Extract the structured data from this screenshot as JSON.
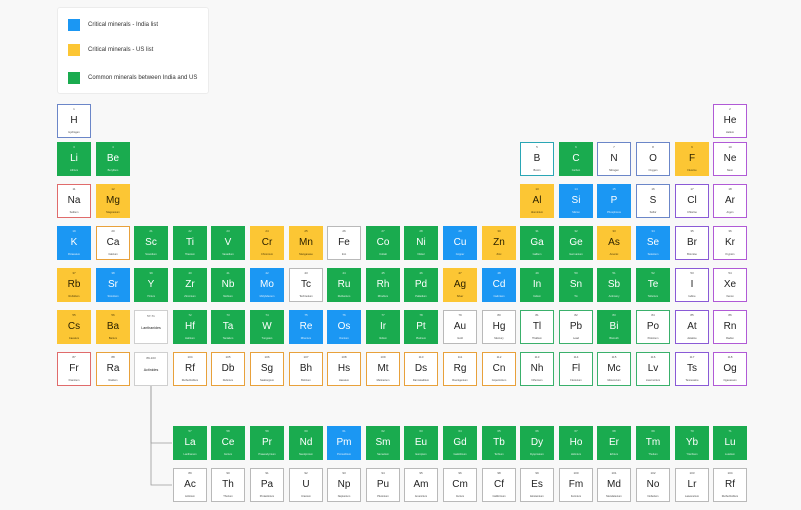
{
  "legend": {
    "items": [
      {
        "label": "Critical minerals - India list",
        "color": "#1b97f3"
      },
      {
        "label": "Critical minerals - US list",
        "color": "#fcc634"
      },
      {
        "label": "Common minerals between India and US",
        "color": "#1aab4f"
      }
    ]
  },
  "colors": {
    "india": "#1b97f3",
    "us": "#fcc634",
    "both": "#1aab4f",
    "group_borders": {
      "nonmetal": "#6b86c8",
      "alkali": "#e06b6b",
      "alkaline": "#e8a13b",
      "transition": "#b9b9b9",
      "post": "#3ab06b",
      "metalloid": "#2aa6b5",
      "halogen": "#8a5ad6",
      "noble": "#b05ad6"
    }
  },
  "placeholders": {
    "lanthanides": {
      "number": "57-71",
      "label": "Lanthanides"
    },
    "actinides": {
      "number": "89-103",
      "label": "Actinides"
    }
  },
  "elements": [
    {
      "sym": "H",
      "num": "1",
      "name": "Hydrogen",
      "row": 1,
      "col": 1,
      "cat": "none",
      "group": "nonmetal"
    },
    {
      "sym": "He",
      "num": "2",
      "name": "Helium",
      "row": 1,
      "col": 18,
      "cat": "none",
      "group": "noble"
    },
    {
      "sym": "Li",
      "num": "3",
      "name": "Lithium",
      "row": 2,
      "col": 1,
      "cat": "both",
      "group": "alkali"
    },
    {
      "sym": "Be",
      "num": "4",
      "name": "Beryllium",
      "row": 2,
      "col": 2,
      "cat": "both",
      "group": "alkaline"
    },
    {
      "sym": "B",
      "num": "5",
      "name": "Boron",
      "row": 2,
      "col": 13,
      "cat": "none",
      "group": "metalloid"
    },
    {
      "sym": "C",
      "num": "6",
      "name": "Carbon",
      "row": 2,
      "col": 14,
      "cat": "both",
      "group": "nonmetal"
    },
    {
      "sym": "N",
      "num": "7",
      "name": "Nitrogen",
      "row": 2,
      "col": 15,
      "cat": "none",
      "group": "nonmetal"
    },
    {
      "sym": "O",
      "num": "8",
      "name": "Oxygen",
      "row": 2,
      "col": 16,
      "cat": "none",
      "group": "nonmetal"
    },
    {
      "sym": "F",
      "num": "9",
      "name": "Fluorine",
      "row": 2,
      "col": 17,
      "cat": "us",
      "group": "halogen"
    },
    {
      "sym": "Ne",
      "num": "10",
      "name": "Neon",
      "row": 2,
      "col": 18,
      "cat": "none",
      "group": "noble"
    },
    {
      "sym": "Na",
      "num": "11",
      "name": "Sodium",
      "row": 3,
      "col": 1,
      "cat": "none",
      "group": "alkali"
    },
    {
      "sym": "Mg",
      "num": "12",
      "name": "Magnesium",
      "row": 3,
      "col": 2,
      "cat": "us",
      "group": "alkaline"
    },
    {
      "sym": "Al",
      "num": "13",
      "name": "Aluminium",
      "row": 3,
      "col": 13,
      "cat": "us",
      "group": "post"
    },
    {
      "sym": "Si",
      "num": "14",
      "name": "Silicon",
      "row": 3,
      "col": 14,
      "cat": "india",
      "group": "metalloid"
    },
    {
      "sym": "P",
      "num": "15",
      "name": "Phosphorus",
      "row": 3,
      "col": 15,
      "cat": "india",
      "group": "nonmetal"
    },
    {
      "sym": "S",
      "num": "16",
      "name": "Sulfur",
      "row": 3,
      "col": 16,
      "cat": "none",
      "group": "nonmetal"
    },
    {
      "sym": "Cl",
      "num": "17",
      "name": "Chlorine",
      "row": 3,
      "col": 17,
      "cat": "none",
      "group": "halogen"
    },
    {
      "sym": "Ar",
      "num": "18",
      "name": "Argon",
      "row": 3,
      "col": 18,
      "cat": "none",
      "group": "noble"
    },
    {
      "sym": "K",
      "num": "19",
      "name": "Potassium",
      "row": 4,
      "col": 1,
      "cat": "india",
      "group": "alkali"
    },
    {
      "sym": "Ca",
      "num": "20",
      "name": "Calcium",
      "row": 4,
      "col": 2,
      "cat": "none",
      "group": "alkaline"
    },
    {
      "sym": "Sc",
      "num": "21",
      "name": "Scandium",
      "row": 4,
      "col": 3,
      "cat": "both",
      "group": "transition"
    },
    {
      "sym": "Ti",
      "num": "22",
      "name": "Titanium",
      "row": 4,
      "col": 4,
      "cat": "both",
      "group": "transition"
    },
    {
      "sym": "V",
      "num": "23",
      "name": "Vanadium",
      "row": 4,
      "col": 5,
      "cat": "both",
      "group": "transition"
    },
    {
      "sym": "Cr",
      "num": "24",
      "name": "Chromium",
      "row": 4,
      "col": 6,
      "cat": "us",
      "group": "transition"
    },
    {
      "sym": "Mn",
      "num": "25",
      "name": "Manganese",
      "row": 4,
      "col": 7,
      "cat": "us",
      "group": "transition"
    },
    {
      "sym": "Fe",
      "num": "26",
      "name": "Iron",
      "row": 4,
      "col": 8,
      "cat": "none",
      "group": "transition"
    },
    {
      "sym": "Co",
      "num": "27",
      "name": "Cobalt",
      "row": 4,
      "col": 9,
      "cat": "both",
      "group": "transition"
    },
    {
      "sym": "Ni",
      "num": "28",
      "name": "Nickel",
      "row": 4,
      "col": 10,
      "cat": "both",
      "group": "transition"
    },
    {
      "sym": "Cu",
      "num": "29",
      "name": "Copper",
      "row": 4,
      "col": 11,
      "cat": "india",
      "group": "transition"
    },
    {
      "sym": "Zn",
      "num": "30",
      "name": "Zinc",
      "row": 4,
      "col": 12,
      "cat": "us",
      "group": "transition"
    },
    {
      "sym": "Ga",
      "num": "31",
      "name": "Gallium",
      "row": 4,
      "col": 13,
      "cat": "both",
      "group": "post"
    },
    {
      "sym": "Ge",
      "num": "32",
      "name": "Germanium",
      "row": 4,
      "col": 14,
      "cat": "both",
      "group": "metalloid"
    },
    {
      "sym": "As",
      "num": "33",
      "name": "Arsenic",
      "row": 4,
      "col": 15,
      "cat": "us",
      "group": "metalloid"
    },
    {
      "sym": "Se",
      "num": "34",
      "name": "Selenium",
      "row": 4,
      "col": 16,
      "cat": "india",
      "group": "nonmetal"
    },
    {
      "sym": "Br",
      "num": "35",
      "name": "Bromine",
      "row": 4,
      "col": 17,
      "cat": "none",
      "group": "halogen"
    },
    {
      "sym": "Kr",
      "num": "36",
      "name": "Krypton",
      "row": 4,
      "col": 18,
      "cat": "none",
      "group": "noble"
    },
    {
      "sym": "Rb",
      "num": "37",
      "name": "Rubidium",
      "row": 5,
      "col": 1,
      "cat": "us",
      "group": "alkali"
    },
    {
      "sym": "Sr",
      "num": "38",
      "name": "Strontium",
      "row": 5,
      "col": 2,
      "cat": "india",
      "group": "alkaline"
    },
    {
      "sym": "Y",
      "num": "39",
      "name": "Yttrium",
      "row": 5,
      "col": 3,
      "cat": "both",
      "group": "transition"
    },
    {
      "sym": "Zr",
      "num": "40",
      "name": "Zirconium",
      "row": 5,
      "col": 4,
      "cat": "both",
      "group": "transition"
    },
    {
      "sym": "Nb",
      "num": "41",
      "name": "Niobium",
      "row": 5,
      "col": 5,
      "cat": "both",
      "group": "transition"
    },
    {
      "sym": "Mo",
      "num": "42",
      "name": "Molybdenum",
      "row": 5,
      "col": 6,
      "cat": "india",
      "group": "transition"
    },
    {
      "sym": "Tc",
      "num": "43",
      "name": "Technetium",
      "row": 5,
      "col": 7,
      "cat": "none",
      "group": "transition"
    },
    {
      "sym": "Ru",
      "num": "44",
      "name": "Ruthenium",
      "row": 5,
      "col": 8,
      "cat": "both",
      "group": "transition"
    },
    {
      "sym": "Rh",
      "num": "45",
      "name": "Rhodium",
      "row": 5,
      "col": 9,
      "cat": "both",
      "group": "transition"
    },
    {
      "sym": "Pd",
      "num": "46",
      "name": "Palladium",
      "row": 5,
      "col": 10,
      "cat": "both",
      "group": "transition"
    },
    {
      "sym": "Ag",
      "num": "47",
      "name": "Silver",
      "row": 5,
      "col": 11,
      "cat": "us",
      "group": "transition"
    },
    {
      "sym": "Cd",
      "num": "48",
      "name": "Cadmium",
      "row": 5,
      "col": 12,
      "cat": "india",
      "group": "transition"
    },
    {
      "sym": "In",
      "num": "49",
      "name": "Indium",
      "row": 5,
      "col": 13,
      "cat": "both",
      "group": "post"
    },
    {
      "sym": "Sn",
      "num": "50",
      "name": "Tin",
      "row": 5,
      "col": 14,
      "cat": "both",
      "group": "post"
    },
    {
      "sym": "Sb",
      "num": "51",
      "name": "Antimony",
      "row": 5,
      "col": 15,
      "cat": "both",
      "group": "metalloid"
    },
    {
      "sym": "Te",
      "num": "52",
      "name": "Tellurium",
      "row": 5,
      "col": 16,
      "cat": "both",
      "group": "metalloid"
    },
    {
      "sym": "I",
      "num": "53",
      "name": "Iodine",
      "row": 5,
      "col": 17,
      "cat": "none",
      "group": "halogen"
    },
    {
      "sym": "Xe",
      "num": "54",
      "name": "Xenon",
      "row": 5,
      "col": 18,
      "cat": "none",
      "group": "noble"
    },
    {
      "sym": "Cs",
      "num": "55",
      "name": "Caesium",
      "row": 6,
      "col": 1,
      "cat": "us",
      "group": "alkali"
    },
    {
      "sym": "Ba",
      "num": "56",
      "name": "Barium",
      "row": 6,
      "col": 2,
      "cat": "us",
      "group": "alkaline"
    },
    {
      "sym": "Hf",
      "num": "72",
      "name": "Hafnium",
      "row": 6,
      "col": 4,
      "cat": "both",
      "group": "transition"
    },
    {
      "sym": "Ta",
      "num": "73",
      "name": "Tantalum",
      "row": 6,
      "col": 5,
      "cat": "both",
      "group": "transition"
    },
    {
      "sym": "W",
      "num": "74",
      "name": "Tungsten",
      "row": 6,
      "col": 6,
      "cat": "both",
      "group": "transition"
    },
    {
      "sym": "Re",
      "num": "75",
      "name": "Rhenium",
      "row": 6,
      "col": 7,
      "cat": "india",
      "group": "transition"
    },
    {
      "sym": "Os",
      "num": "76",
      "name": "Osmium",
      "row": 6,
      "col": 8,
      "cat": "india",
      "group": "transition"
    },
    {
      "sym": "Ir",
      "num": "77",
      "name": "Iridium",
      "row": 6,
      "col": 9,
      "cat": "both",
      "group": "transition"
    },
    {
      "sym": "Pt",
      "num": "78",
      "name": "Platinum",
      "row": 6,
      "col": 10,
      "cat": "both",
      "group": "transition"
    },
    {
      "sym": "Au",
      "num": "79",
      "name": "Gold",
      "row": 6,
      "col": 11,
      "cat": "none",
      "group": "transition"
    },
    {
      "sym": "Hg",
      "num": "80",
      "name": "Mercury",
      "row": 6,
      "col": 12,
      "cat": "none",
      "group": "transition"
    },
    {
      "sym": "Tl",
      "num": "81",
      "name": "Thallium",
      "row": 6,
      "col": 13,
      "cat": "none",
      "group": "post"
    },
    {
      "sym": "Pb",
      "num": "82",
      "name": "Lead",
      "row": 6,
      "col": 14,
      "cat": "none",
      "group": "post"
    },
    {
      "sym": "Bi",
      "num": "83",
      "name": "Bismuth",
      "row": 6,
      "col": 15,
      "cat": "both",
      "group": "post"
    },
    {
      "sym": "Po",
      "num": "84",
      "name": "Polonium",
      "row": 6,
      "col": 16,
      "cat": "none",
      "group": "post"
    },
    {
      "sym": "At",
      "num": "85",
      "name": "Astatine",
      "row": 6,
      "col": 17,
      "cat": "none",
      "group": "halogen"
    },
    {
      "sym": "Rn",
      "num": "86",
      "name": "Radon",
      "row": 6,
      "col": 18,
      "cat": "none",
      "group": "noble"
    },
    {
      "sym": "Fr",
      "num": "87",
      "name": "Francium",
      "row": 7,
      "col": 1,
      "cat": "none",
      "group": "alkali"
    },
    {
      "sym": "Ra",
      "num": "88",
      "name": "Radium",
      "row": 7,
      "col": 2,
      "cat": "none",
      "group": "alkaline"
    },
    {
      "sym": "Rf",
      "num": "104",
      "name": "Rutherfordium",
      "row": 7,
      "col": 4,
      "cat": "none",
      "group": "alkaline"
    },
    {
      "sym": "Db",
      "num": "105",
      "name": "Dubnium",
      "row": 7,
      "col": 5,
      "cat": "none",
      "group": "alkaline"
    },
    {
      "sym": "Sg",
      "num": "106",
      "name": "Seaborgium",
      "row": 7,
      "col": 6,
      "cat": "none",
      "group": "alkaline"
    },
    {
      "sym": "Bh",
      "num": "107",
      "name": "Bohrium",
      "row": 7,
      "col": 7,
      "cat": "none",
      "group": "alkaline"
    },
    {
      "sym": "Hs",
      "num": "108",
      "name": "Hassium",
      "row": 7,
      "col": 8,
      "cat": "none",
      "group": "alkaline"
    },
    {
      "sym": "Mt",
      "num": "109",
      "name": "Meitnerium",
      "row": 7,
      "col": 9,
      "cat": "none",
      "group": "alkaline"
    },
    {
      "sym": "Ds",
      "num": "110",
      "name": "Darmstadtium",
      "row": 7,
      "col": 10,
      "cat": "none",
      "group": "alkaline"
    },
    {
      "sym": "Rg",
      "num": "111",
      "name": "Roentgenium",
      "row": 7,
      "col": 11,
      "cat": "none",
      "group": "alkaline"
    },
    {
      "sym": "Cn",
      "num": "112",
      "name": "Copernicium",
      "row": 7,
      "col": 12,
      "cat": "none",
      "group": "alkaline"
    },
    {
      "sym": "Nh",
      "num": "113",
      "name": "Nihonium",
      "row": 7,
      "col": 13,
      "cat": "none",
      "group": "post"
    },
    {
      "sym": "Fl",
      "num": "114",
      "name": "Flerovium",
      "row": 7,
      "col": 14,
      "cat": "none",
      "group": "post"
    },
    {
      "sym": "Mc",
      "num": "115",
      "name": "Moscovium",
      "row": 7,
      "col": 15,
      "cat": "none",
      "group": "post"
    },
    {
      "sym": "Lv",
      "num": "116",
      "name": "Livermorium",
      "row": 7,
      "col": 16,
      "cat": "none",
      "group": "post"
    },
    {
      "sym": "Ts",
      "num": "117",
      "name": "Tennessine",
      "row": 7,
      "col": 17,
      "cat": "none",
      "group": "halogen"
    },
    {
      "sym": "Og",
      "num": "118",
      "name": "Oganesson",
      "row": 7,
      "col": 18,
      "cat": "none",
      "group": "noble"
    },
    {
      "sym": "La",
      "num": "57",
      "name": "Lanthanum",
      "row": 9,
      "col": 4,
      "cat": "both",
      "group": "transition"
    },
    {
      "sym": "Ce",
      "num": "58",
      "name": "Cerium",
      "row": 9,
      "col": 5,
      "cat": "both",
      "group": "transition"
    },
    {
      "sym": "Pr",
      "num": "59",
      "name": "Praseodymium",
      "row": 9,
      "col": 6,
      "cat": "both",
      "group": "transition"
    },
    {
      "sym": "Nd",
      "num": "60",
      "name": "Neodymium",
      "row": 9,
      "col": 7,
      "cat": "both",
      "group": "transition"
    },
    {
      "sym": "Pm",
      "num": "61",
      "name": "Promethium",
      "row": 9,
      "col": 8,
      "cat": "india",
      "group": "transition"
    },
    {
      "sym": "Sm",
      "num": "62",
      "name": "Samarium",
      "row": 9,
      "col": 9,
      "cat": "both",
      "group": "transition"
    },
    {
      "sym": "Eu",
      "num": "63",
      "name": "Europium",
      "row": 9,
      "col": 10,
      "cat": "both",
      "group": "transition"
    },
    {
      "sym": "Gd",
      "num": "64",
      "name": "Gadolinium",
      "row": 9,
      "col": 11,
      "cat": "both",
      "group": "transition"
    },
    {
      "sym": "Tb",
      "num": "65",
      "name": "Terbium",
      "row": 9,
      "col": 12,
      "cat": "both",
      "group": "transition"
    },
    {
      "sym": "Dy",
      "num": "66",
      "name": "Dysprosium",
      "row": 9,
      "col": 13,
      "cat": "both",
      "group": "transition"
    },
    {
      "sym": "Ho",
      "num": "67",
      "name": "Holmium",
      "row": 9,
      "col": 14,
      "cat": "both",
      "group": "transition"
    },
    {
      "sym": "Er",
      "num": "68",
      "name": "Erbium",
      "row": 9,
      "col": 15,
      "cat": "both",
      "group": "transition"
    },
    {
      "sym": "Tm",
      "num": "69",
      "name": "Thulium",
      "row": 9,
      "col": 16,
      "cat": "both",
      "group": "transition"
    },
    {
      "sym": "Yb",
      "num": "70",
      "name": "Ytterbium",
      "row": 9,
      "col": 17,
      "cat": "both",
      "group": "transition"
    },
    {
      "sym": "Lu",
      "num": "71",
      "name": "Lutetium",
      "row": 9,
      "col": 18,
      "cat": "both",
      "group": "transition"
    },
    {
      "sym": "Ac",
      "num": "89",
      "name": "Actinium",
      "row": 10,
      "col": 4,
      "cat": "none",
      "group": "transition"
    },
    {
      "sym": "Th",
      "num": "90",
      "name": "Thorium",
      "row": 10,
      "col": 5,
      "cat": "none",
      "group": "transition"
    },
    {
      "sym": "Pa",
      "num": "91",
      "name": "Protactinium",
      "row": 10,
      "col": 6,
      "cat": "none",
      "group": "transition"
    },
    {
      "sym": "U",
      "num": "92",
      "name": "Uranium",
      "row": 10,
      "col": 7,
      "cat": "none",
      "group": "transition"
    },
    {
      "sym": "Np",
      "num": "93",
      "name": "Neptunium",
      "row": 10,
      "col": 8,
      "cat": "none",
      "group": "transition"
    },
    {
      "sym": "Pu",
      "num": "94",
      "name": "Plutonium",
      "row": 10,
      "col": 9,
      "cat": "none",
      "group": "transition"
    },
    {
      "sym": "Am",
      "num": "95",
      "name": "Americium",
      "row": 10,
      "col": 10,
      "cat": "none",
      "group": "transition"
    },
    {
      "sym": "Cm",
      "num": "96",
      "name": "Curium",
      "row": 10,
      "col": 11,
      "cat": "none",
      "group": "transition"
    },
    {
      "sym": "Cf",
      "num": "98",
      "name": "Californium",
      "row": 10,
      "col": 12,
      "cat": "none",
      "group": "transition"
    },
    {
      "sym": "Es",
      "num": "99",
      "name": "Einsteinium",
      "row": 10,
      "col": 13,
      "cat": "none",
      "group": "transition"
    },
    {
      "sym": "Fm",
      "num": "100",
      "name": "Fermium",
      "row": 10,
      "col": 14,
      "cat": "none",
      "group": "transition"
    },
    {
      "sym": "Md",
      "num": "101",
      "name": "Mendelevium",
      "row": 10,
      "col": 15,
      "cat": "none",
      "group": "transition"
    },
    {
      "sym": "No",
      "num": "102",
      "name": "Nobelium",
      "row": 10,
      "col": 16,
      "cat": "none",
      "group": "transition"
    },
    {
      "sym": "Lr",
      "num": "103",
      "name": "Lawrencium",
      "row": 10,
      "col": 17,
      "cat": "none",
      "group": "transition"
    },
    {
      "sym": "Rf",
      "num": "104",
      "name": "Rutherfordium",
      "row": 10,
      "col": 18,
      "cat": "none",
      "group": "transition"
    }
  ]
}
